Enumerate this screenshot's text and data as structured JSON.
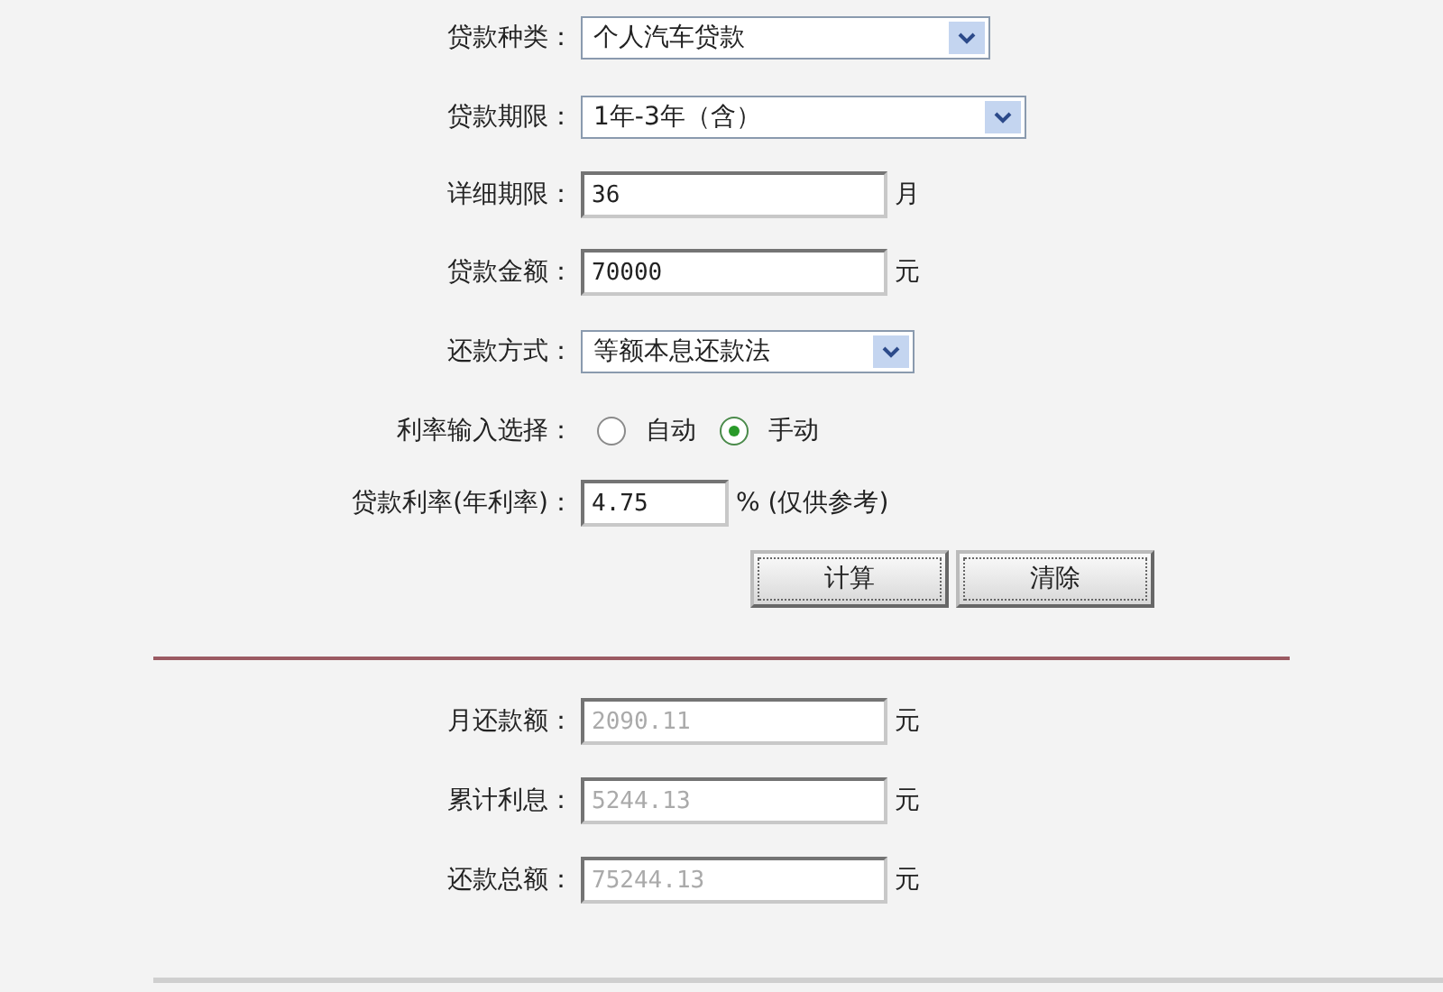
{
  "form": {
    "fields": [
      {
        "kind": "select",
        "label": "贷款种类：",
        "value": "个人汽车贷款"
      },
      {
        "kind": "select",
        "label": "贷款期限：",
        "value": "1年-3年（含）"
      },
      {
        "kind": "text",
        "label": "详细期限：",
        "value": "36",
        "unit": "月"
      },
      {
        "kind": "text",
        "label": "贷款金额：",
        "value": "70000",
        "unit": "元"
      },
      {
        "kind": "select",
        "label": "还款方式：",
        "value": "等额本息还款法"
      },
      {
        "kind": "radio",
        "label": "利率输入选择：",
        "options": [
          {
            "label": "自动",
            "selected": false
          },
          {
            "label": "手动",
            "selected": true
          }
        ]
      },
      {
        "kind": "text",
        "label": "贷款利率(年利率)：",
        "value": "4.75",
        "unit": "% (仅供参考)"
      }
    ],
    "buttons": [
      "计算",
      "清除"
    ]
  },
  "results": [
    {
      "label": "月还款额：",
      "value": "2090.11",
      "unit": "元",
      "disabled": true
    },
    {
      "label": "累计利息：",
      "value": "5244.13",
      "unit": "元",
      "disabled": true
    },
    {
      "label": "还款总额：",
      "value": "75244.13",
      "unit": "元",
      "disabled": true
    }
  ]
}
